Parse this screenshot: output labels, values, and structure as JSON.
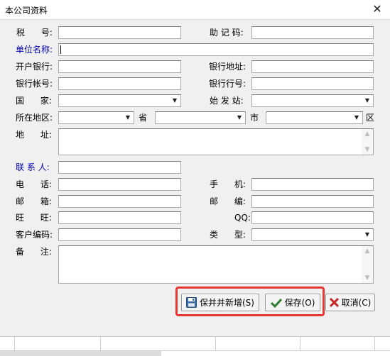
{
  "window": {
    "title": "本公司资料",
    "close_glyph": "✕"
  },
  "fields": {
    "tax_no": {
      "label": "税      号:",
      "value": ""
    },
    "mnemonic": {
      "label": "助 记 码:",
      "value": ""
    },
    "company_name": {
      "label": "单位名称:",
      "value": ""
    },
    "bank": {
      "label": "开户银行:",
      "value": ""
    },
    "bank_address": {
      "label": "银行地址:",
      "value": ""
    },
    "bank_account": {
      "label": "银行帐号:",
      "value": ""
    },
    "bank_code": {
      "label": "银行行号:",
      "value": ""
    },
    "country": {
      "label": "国      家:",
      "value": ""
    },
    "origin_station": {
      "label": "始 发 站:",
      "value": ""
    },
    "region": {
      "label": "所在地区:",
      "value": ""
    },
    "province": {
      "label": "省",
      "value": ""
    },
    "city": {
      "label": "市",
      "value": ""
    },
    "district": {
      "label": "区"
    },
    "address": {
      "label": "地      址:",
      "value": ""
    },
    "contact": {
      "label": "联 系 人:",
      "value": ""
    },
    "phone": {
      "label": "电      话:",
      "value": ""
    },
    "mobile": {
      "label": "手      机:",
      "value": ""
    },
    "email": {
      "label": "邮      箱:",
      "value": ""
    },
    "postcode": {
      "label": "邮      编:",
      "value": ""
    },
    "wangwang": {
      "label": "旺      旺:",
      "value": ""
    },
    "qq": {
      "label": "QQ:",
      "value": ""
    },
    "customer_code": {
      "label": "客户编码:",
      "value": ""
    },
    "type": {
      "label": "类      型:",
      "value": ""
    },
    "remark": {
      "label": "备      注:",
      "value": ""
    }
  },
  "buttons": {
    "save_new": "保并并新增(S)",
    "save": "保存(O)",
    "cancel": "取消(C)"
  },
  "colors": {
    "blue_label": "#0000aa",
    "highlight": "#e53935",
    "save_check": "#2e7d32",
    "cancel_x": "#c62828"
  }
}
